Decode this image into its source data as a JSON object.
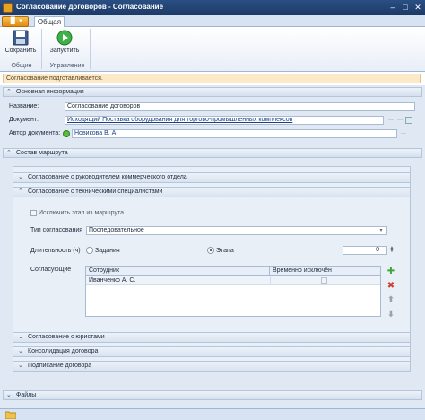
{
  "window": {
    "title": "Согласование договоров - Согласование",
    "minimize": "–",
    "maximize": "□",
    "close": "✕"
  },
  "ribbon": {
    "tab": "Общая",
    "file_menu": "▐▌ ▾",
    "save_label": "Сохранить",
    "start_label": "Запустить",
    "group_general": "Общие",
    "group_control": "Управление"
  },
  "status_text": "Согласование подготавливается.",
  "basic_info": {
    "header": "Основная информация",
    "name_label": "Название:",
    "name_value": "Согласование договоров",
    "document_label": "Документ:",
    "document_value": "Исходящий Поставка оборудования для торгово-промышленных комплексов",
    "author_label": "Автор документа:",
    "author_value": "Новикова В. А."
  },
  "route": {
    "header": "Состав маршрута",
    "stage_management": "Согласование с руководителем коммерческого отдела",
    "stage_tech": "Согласование с техническими специалистами",
    "exclude_label": "Исключить этап из маршрута",
    "type_label": "Тип согласования",
    "type_value": "Последовательное",
    "duration_label": "Длительность (ч)",
    "radio_task": "Задания",
    "radio_stage": "Этапа",
    "duration_value": "0",
    "approvers_label": "Согласующие",
    "col_employee": "Сотрудник",
    "col_excluded": "Временно исключён",
    "approvers": [
      {
        "employee": "Иванченко А. С.",
        "excluded": ""
      }
    ],
    "stage_lawyers": "Согласование с юристами",
    "stage_consolidation": "Консолидация договора",
    "stage_signing": "Подписание договора"
  },
  "files_header": "Файлы",
  "colors": {
    "accent": "#2a4f84",
    "panel_bg": "#dfe8f3",
    "status_bg": "#fbe9c8"
  }
}
